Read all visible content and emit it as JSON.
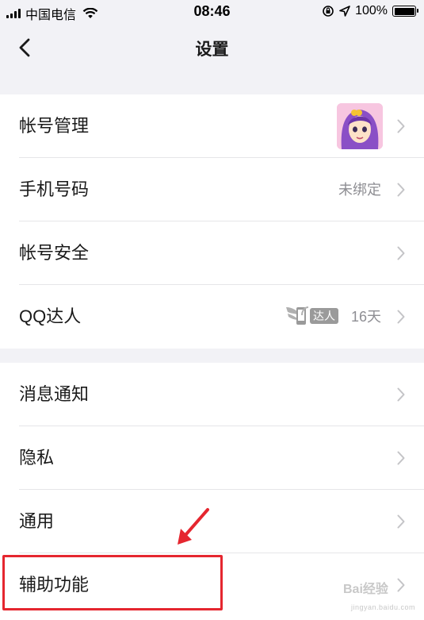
{
  "status_bar": {
    "carrier": "中国电信",
    "time": "08:46",
    "battery": "100%",
    "icons": [
      "signal-icon",
      "wifi-icon",
      "orientation-lock-icon",
      "location-icon",
      "battery-icon"
    ]
  },
  "nav": {
    "title": "设置",
    "back_icon": "chevron-left-icon"
  },
  "groups": [
    {
      "items": [
        {
          "label": "帐号管理",
          "accessory": "avatar"
        },
        {
          "label": "手机号码",
          "value": "未绑定"
        },
        {
          "label": "帐号安全"
        },
        {
          "label": "QQ达人",
          "badge": "达人",
          "value": "16天"
        }
      ]
    },
    {
      "items": [
        {
          "label": "消息通知"
        },
        {
          "label": "隐私"
        },
        {
          "label": "通用"
        },
        {
          "label": "辅助功能"
        }
      ]
    }
  ],
  "annotation": {
    "highlight_color": "#e5262f",
    "target": "辅助功能"
  },
  "watermark": {
    "text": "Bai经验",
    "sub": "jingyan.baidu.com"
  },
  "colors": {
    "background": "#f2f2f6",
    "cell": "#ffffff",
    "secondary_text": "#8e8e93",
    "chevron": "#c4c4c7"
  }
}
